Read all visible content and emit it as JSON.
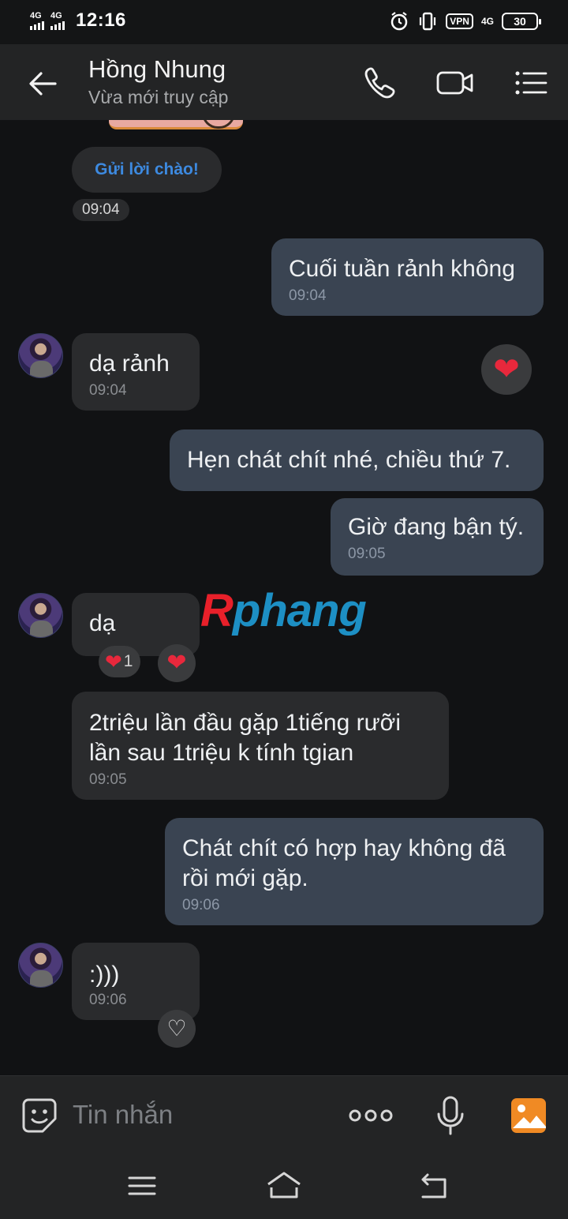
{
  "status_bar": {
    "signal1_label": "4G",
    "signal2_label": "4G",
    "time": "12:16",
    "vpn_label": "VPN",
    "network_label": "4G",
    "battery": "30"
  },
  "header": {
    "contact_name": "Hồng Nhung",
    "presence": "Vừa mới truy cập"
  },
  "chat": {
    "greeting_button": "Gửi lời chào!",
    "greeting_time": "09:04",
    "messages": [
      {
        "text": "Cuối tuần rảnh không",
        "time": "09:04"
      },
      {
        "text": "dạ rảnh",
        "time": "09:04"
      },
      {
        "text": "Hẹn chát chít nhé, chiều thứ 7.",
        "time": ""
      },
      {
        "text": "Giờ đang bận tý.",
        "time": "09:05"
      },
      {
        "text": "dạ",
        "time": ""
      },
      {
        "text": "2triệu lần đầu gặp 1tiếng rưỡi\nlần sau 1triệu k tính tgian",
        "time": "09:05"
      },
      {
        "text": "Chát chít có hợp hay không đã\nrồi mới gặp.",
        "time": "09:06"
      },
      {
        "text": ":)))",
        "time": "09:06"
      }
    ],
    "reaction_count": "1",
    "watermark": {
      "first": "R",
      "rest": "phang"
    }
  },
  "input": {
    "placeholder": "Tin nhắn"
  },
  "icons": {
    "back": "back-arrow-icon",
    "call": "phone-icon",
    "video": "video-camera-icon",
    "menu": "list-menu-icon",
    "emoji": "sticker-emoji-icon",
    "more": "more-dots-icon",
    "mic": "microphone-icon",
    "photo": "image-icon",
    "heart": "heart-icon"
  },
  "colors": {
    "background": "#111214",
    "incoming_bubble": "#2a2b2d",
    "outgoing_bubble": "#3a4452",
    "accent_blue": "#3d8ae0",
    "heart_red": "#e8283c",
    "photo_icon": "#f08a24"
  }
}
